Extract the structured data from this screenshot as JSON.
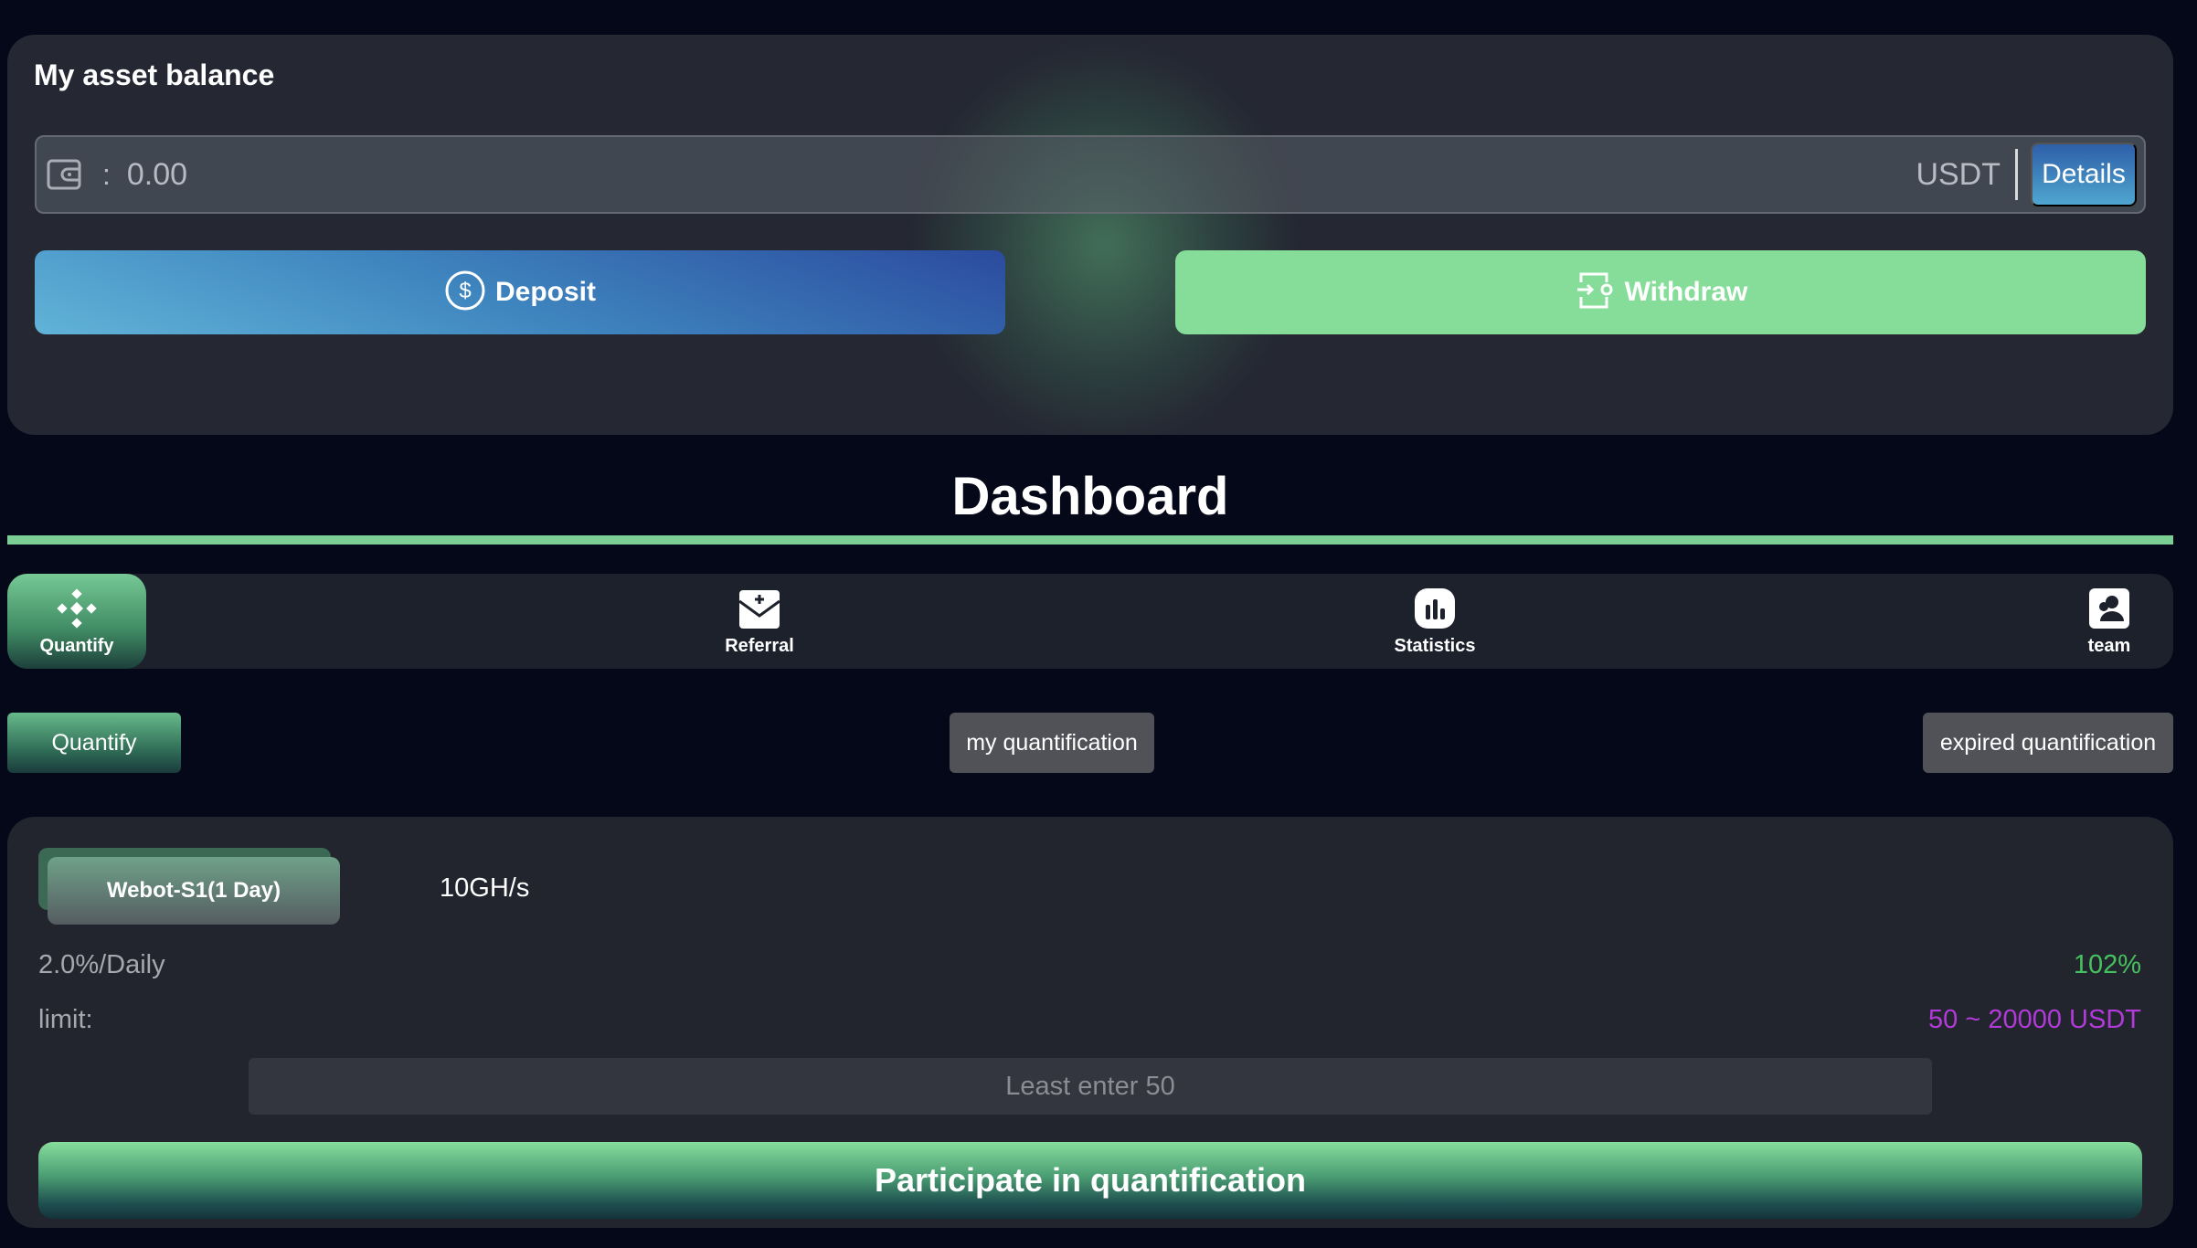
{
  "asset": {
    "title": "My asset balance",
    "colon": ":",
    "balance": "0.00",
    "currency": "USDT",
    "details_label": "Details",
    "deposit_label": "Deposit",
    "withdraw_label": "Withdraw"
  },
  "dashboard": {
    "title": "Dashboard"
  },
  "nav": {
    "items": [
      {
        "label": "Quantify",
        "icon": "binance-diamond-icon"
      },
      {
        "label": "Referral",
        "icon": "envelope-plus-icon"
      },
      {
        "label": "Statistics",
        "icon": "bar-chart-icon"
      },
      {
        "label": "team",
        "icon": "team-icon"
      }
    ]
  },
  "subtabs": {
    "quantify": "Quantify",
    "my": "my quantification",
    "expired": "expired quantification"
  },
  "product": {
    "name": "Webot-S1(1 Day)",
    "hashrate": "10GH/s",
    "rate": "2.0%/Daily",
    "total_return": "102%",
    "limit_label": "limit:",
    "limit_range": "50 ~ 20000 USDT",
    "amount_placeholder": "Least enter 50",
    "participate_label": "Participate in quantification"
  },
  "colors": {
    "background": "#050818",
    "accent_green": "#86dd9a",
    "accent_blue": "#3f86bf",
    "return_green": "#46c15d",
    "limit_purple": "#b13ad8"
  }
}
